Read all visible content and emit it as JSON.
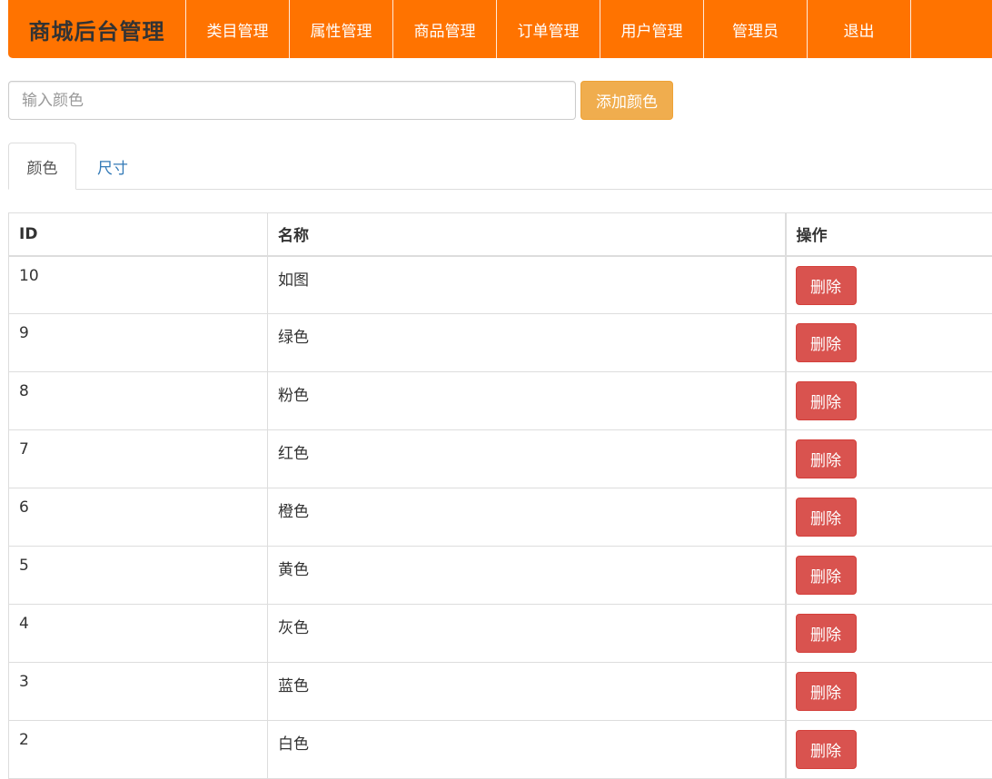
{
  "navbar": {
    "brand": "商城后台管理",
    "items": [
      {
        "label": "类目管理"
      },
      {
        "label": "属性管理"
      },
      {
        "label": "商品管理"
      },
      {
        "label": "订单管理"
      },
      {
        "label": "用户管理"
      },
      {
        "label": "管理员"
      },
      {
        "label": "退出"
      }
    ]
  },
  "form": {
    "placeholder": "输入颜色",
    "value": "",
    "add_label": "添加颜色"
  },
  "tabs": [
    {
      "label": "颜色",
      "active": true
    },
    {
      "label": "尺寸",
      "active": false
    }
  ],
  "table": {
    "headers": {
      "id": "ID",
      "name": "名称",
      "op": "操作"
    },
    "delete_label": "删除",
    "rows": [
      {
        "id": "10",
        "name": "如图"
      },
      {
        "id": "9",
        "name": "绿色"
      },
      {
        "id": "8",
        "name": "粉色"
      },
      {
        "id": "7",
        "name": "红色"
      },
      {
        "id": "6",
        "name": "橙色"
      },
      {
        "id": "5",
        "name": "黄色"
      },
      {
        "id": "4",
        "name": "灰色"
      },
      {
        "id": "3",
        "name": "蓝色"
      },
      {
        "id": "2",
        "name": "白色"
      }
    ]
  },
  "colors": {
    "navbar": "#ff7300",
    "add_button": "#f0ad4e",
    "delete_button": "#d9534f",
    "tab_link": "#337ab7"
  }
}
